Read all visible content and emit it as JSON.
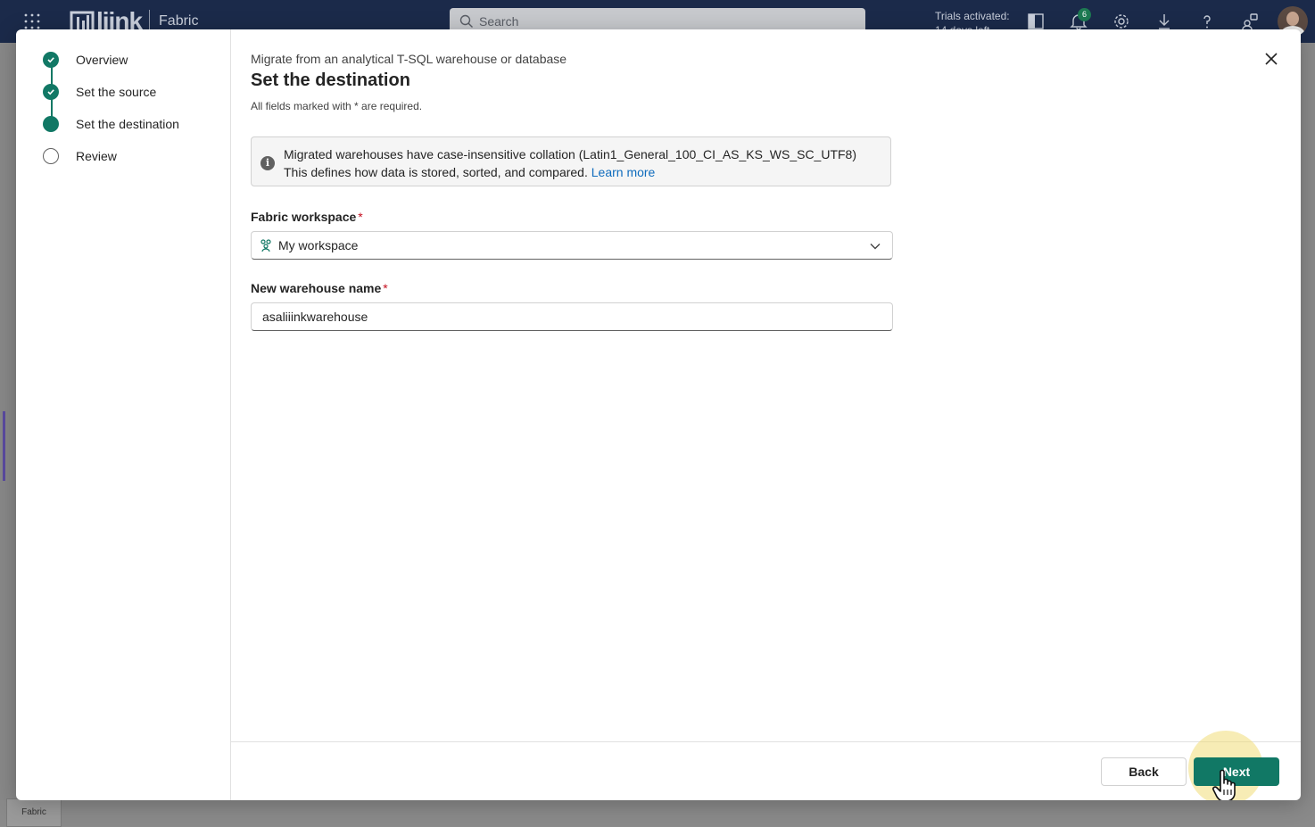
{
  "topbar": {
    "brand": "liink",
    "product": "Fabric",
    "search_placeholder": "Search",
    "trials_line1": "Trials activated:",
    "trials_line2": "14 days left",
    "notifications_count": "6"
  },
  "background": {
    "bottom_tab_label": "Fabric"
  },
  "wizard": {
    "steps": [
      {
        "label": "Overview",
        "state": "done"
      },
      {
        "label": "Set the source",
        "state": "done"
      },
      {
        "label": "Set the destination",
        "state": "current"
      },
      {
        "label": "Review",
        "state": "todo"
      }
    ],
    "breadcrumb": "Migrate from an analytical T-SQL warehouse or database",
    "title": "Set the destination",
    "required_note": "All fields marked with * are required.",
    "info": {
      "bold_text": "Migrated warehouses have case-insensitive collation (Latin1_General_100_CI_AS_KS_WS_SC_UTF8)",
      "text": " This defines how data is stored, sorted, and compared. ",
      "link": "Learn more"
    },
    "workspace_label": "Fabric workspace",
    "workspace_value": "My workspace",
    "warehouse_label": "New warehouse name",
    "warehouse_value": "asaliiinkwarehouse",
    "required_mark": "*",
    "back_label": "Back",
    "next_label": "Next"
  },
  "colors": {
    "accent": "#117865",
    "link": "#0f6cbd",
    "required": "#c50f1f"
  }
}
